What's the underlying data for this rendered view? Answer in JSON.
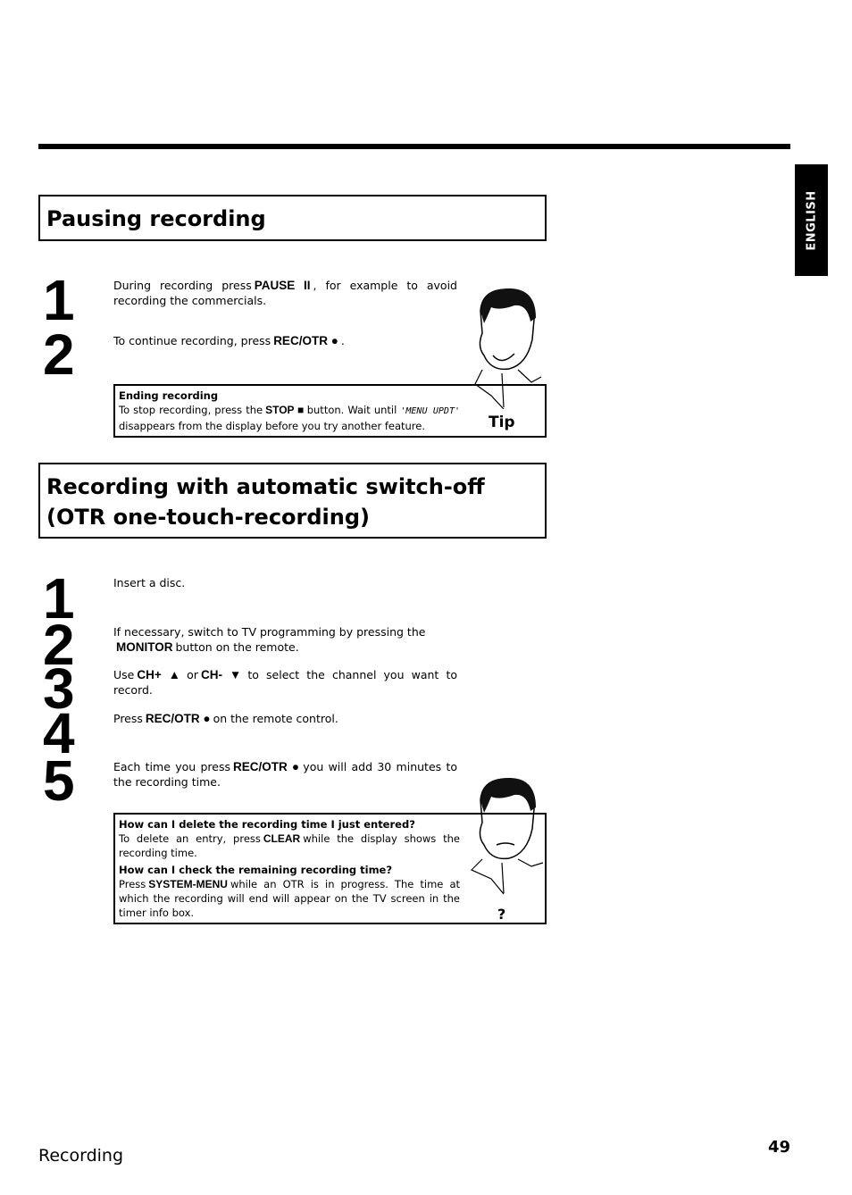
{
  "side_tab": {
    "label": "ENGLISH"
  },
  "section1": {
    "title": "Pausing recording",
    "steps": [
      {
        "num": "1",
        "pre": "During recording press",
        "key": "PAUSE II",
        "post": ", for example to avoid recording the commercials."
      },
      {
        "num": "2",
        "pre": "To continue recording, press",
        "key": "REC/OTR ●",
        "post": "."
      }
    ],
    "tip": {
      "title": "Ending recording",
      "pre": "To stop recording, press the",
      "key": "STOP ■",
      "mid": "button. Wait until",
      "lcd": "'MENU UPDT'",
      "post": "disappears from the display before you try another feature.",
      "label": "Tip"
    }
  },
  "section2": {
    "title_line1": "Recording with automatic switch-off",
    "title_line2": "(OTR one-touch-recording)",
    "steps": [
      {
        "num": "1",
        "text": "Insert a disc."
      },
      {
        "num": "2",
        "pre": "If necessary, switch to TV programming by pressing the",
        "key": "MONITOR",
        "post": "button on the remote."
      },
      {
        "num": "3",
        "pre": "Use",
        "key": "CH+ ▲",
        "mid": "or",
        "key2": "CH- ▼",
        "post": "to select the channel you want to record."
      },
      {
        "num": "4",
        "pre": "Press",
        "key": "REC/OTR ●",
        "post": "on the remote control."
      },
      {
        "num": "5",
        "pre": "Each time you press",
        "key": "REC/OTR ●",
        "post": "you will add 30 minutes to the recording time."
      }
    ],
    "faq": {
      "q1": "How can I delete the recording time I just entered?",
      "a1_pre": "To delete an entry, press",
      "a1_key": "CLEAR",
      "a1_post": "while the display shows the recording time.",
      "q2": "How can I check the remaining recording time?",
      "a2_pre": "Press",
      "a2_key": "SYSTEM-MENU",
      "a2_post": "while an OTR is in progress. The time at which the recording will end will appear on the TV screen in the timer info box.",
      "label": "?"
    }
  },
  "footer": {
    "section": "Recording",
    "page": "49"
  }
}
